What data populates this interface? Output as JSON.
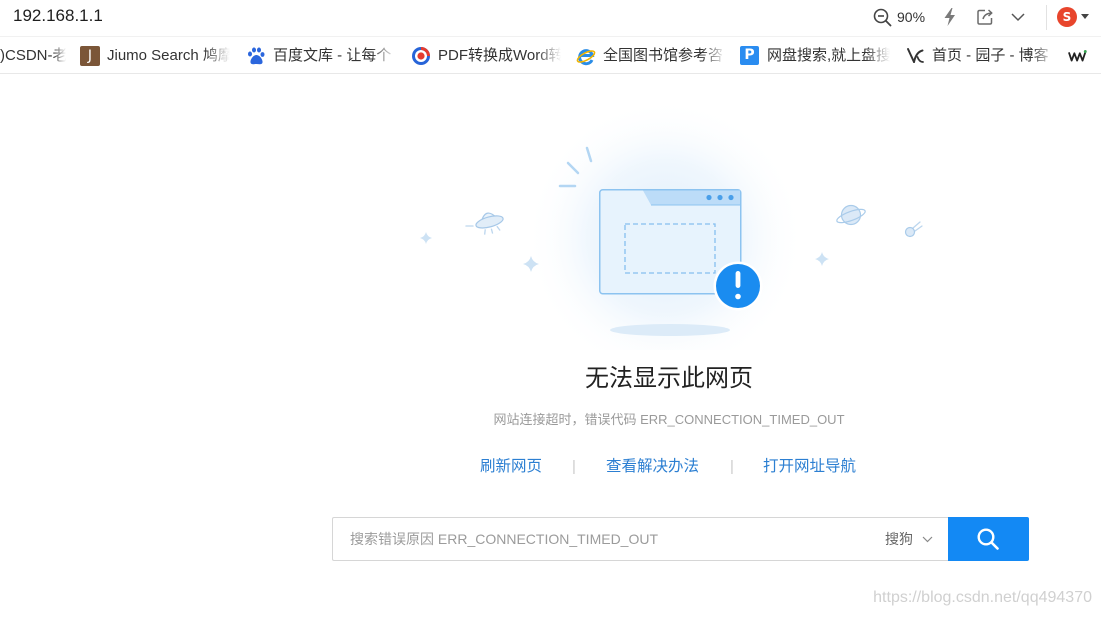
{
  "toolbar": {
    "address": "192.168.1.1",
    "zoom": "90%",
    "zoom_icon": "zoom-out-icon",
    "speed_icon": "lightning-icon",
    "share_icon": "share-icon",
    "menu_icon": "chevron-down-icon",
    "profile_icon": "sogou-logo-icon",
    "profile_letter": "S",
    "profile_menu_icon": "dropdown-arrow-icon"
  },
  "bookmarks": [
    {
      "label": ")CSDN-老"
    },
    {
      "label": "Jiumo Search 鸠摩",
      "icon": "jiumo-icon",
      "icon_letter": "J"
    },
    {
      "label": "百度文库 - 让每个",
      "icon": "baidu-paw-icon"
    },
    {
      "label": "PDF转换成Word转",
      "icon": "pdf-converter-icon"
    },
    {
      "label": "全国图书馆参考咨",
      "icon": "ie-icon"
    },
    {
      "label": "网盘搜索,就上盘搜",
      "icon": "pansou-icon",
      "icon_letter": "P"
    },
    {
      "label": "首页 - 园子 - 博客",
      "icon": "cnblogs-icon"
    },
    {
      "icon": "vvv-icon"
    }
  ],
  "error": {
    "illustration": "browser-window-alert-icon",
    "title": "无法显示此网页",
    "message": "网站连接超时，错误代码 ERR_CONNECTION_TIMED_OUT",
    "separator": "|",
    "actions": [
      {
        "label": "刷新网页"
      },
      {
        "label": "查看解决办法"
      },
      {
        "label": "打开网址导航"
      }
    ]
  },
  "search": {
    "placeholder": "搜索错误原因 ERR_CONNECTION_TIMED_OUT",
    "engine": "搜狗",
    "engine_icon": "chevron-down-icon",
    "button_icon": "search-icon"
  },
  "watermark": "https://blog.csdn.net/qq494370",
  "colors": {
    "accent": "#1389f4",
    "link": "#2c7fd2",
    "title": "#222222",
    "muted": "#9a9a9a",
    "alert": "#1a8cf0",
    "sogou": "#e8452c"
  }
}
